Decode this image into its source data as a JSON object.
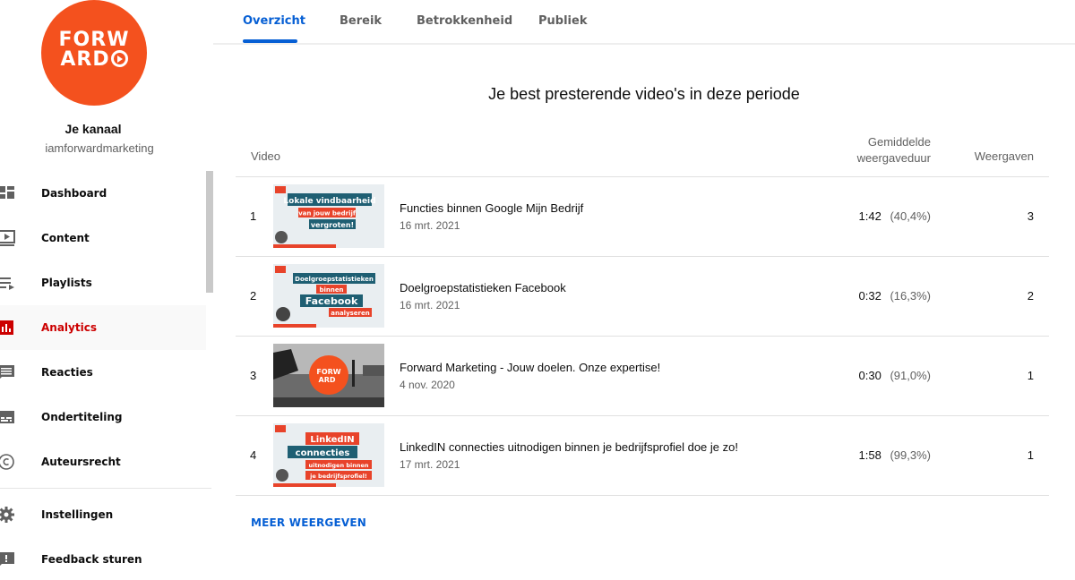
{
  "channel": {
    "logo_text_line1": "FORW",
    "logo_text_line2": "ARD",
    "title": "Je kanaal",
    "handle": "iamforwardmarketing",
    "brand_color": "#f4511e"
  },
  "sidebar": {
    "items": [
      {
        "label": "Dashboard",
        "icon": "dashboard-icon"
      },
      {
        "label": "Content",
        "icon": "video-content-icon"
      },
      {
        "label": "Playlists",
        "icon": "playlist-icon"
      },
      {
        "label": "Analytics",
        "icon": "analytics-icon",
        "active": true
      },
      {
        "label": "Reacties",
        "icon": "comment-icon"
      },
      {
        "label": "Ondertiteling",
        "icon": "subtitles-icon"
      },
      {
        "label": "Auteursrecht",
        "icon": "copyright-icon"
      },
      {
        "label": "Instellingen",
        "icon": "gear-icon"
      },
      {
        "label": "Feedback sturen",
        "icon": "feedback-icon"
      }
    ]
  },
  "tabs": [
    {
      "label": "Overzicht",
      "active": true
    },
    {
      "label": "Bereik"
    },
    {
      "label": "Betrokkenheid"
    },
    {
      "label": "Publiek"
    }
  ],
  "main": {
    "title": "Je best presterende video's in deze periode",
    "columns": {
      "video": "Video",
      "duration_line1": "Gemiddelde",
      "duration_line2": "weergaveduur",
      "views": "Weergaven"
    },
    "rows": [
      {
        "rank": "1",
        "title": "Functies binnen Google Mijn Bedrijf",
        "date": "16 mrt. 2021",
        "duration": "1:42",
        "pct": "(40,4%)",
        "views": "3",
        "thumb": [
          "Lokale vindbaarheid",
          "van jouw bedrijf",
          "vergroten!"
        ]
      },
      {
        "rank": "2",
        "title": "Doelgroepstatistieken Facebook",
        "date": "16 mrt. 2021",
        "duration": "0:32",
        "pct": "(16,3%)",
        "views": "2",
        "thumb": [
          "Doelgroepstatistieken",
          "binnen",
          "Facebook",
          "analyseren"
        ]
      },
      {
        "rank": "3",
        "title": "Forward Marketing - Jouw doelen. Onze expertise!",
        "date": "4 nov. 2020",
        "duration": "0:30",
        "pct": "(91,0%)",
        "views": "1",
        "thumb": [
          "FORW",
          "ARD"
        ]
      },
      {
        "rank": "4",
        "title": "LinkedIN connecties uitnodigen binnen je bedrijfsprofiel doe je zo!",
        "date": "17 mrt. 2021",
        "duration": "1:58",
        "pct": "(99,3%)",
        "views": "1",
        "thumb": [
          "LinkedIN",
          "connecties",
          "uitnodigen binnen",
          "je bedrijfsprofiel!"
        ]
      }
    ],
    "more_label": "MEER WEERGEVEN"
  }
}
